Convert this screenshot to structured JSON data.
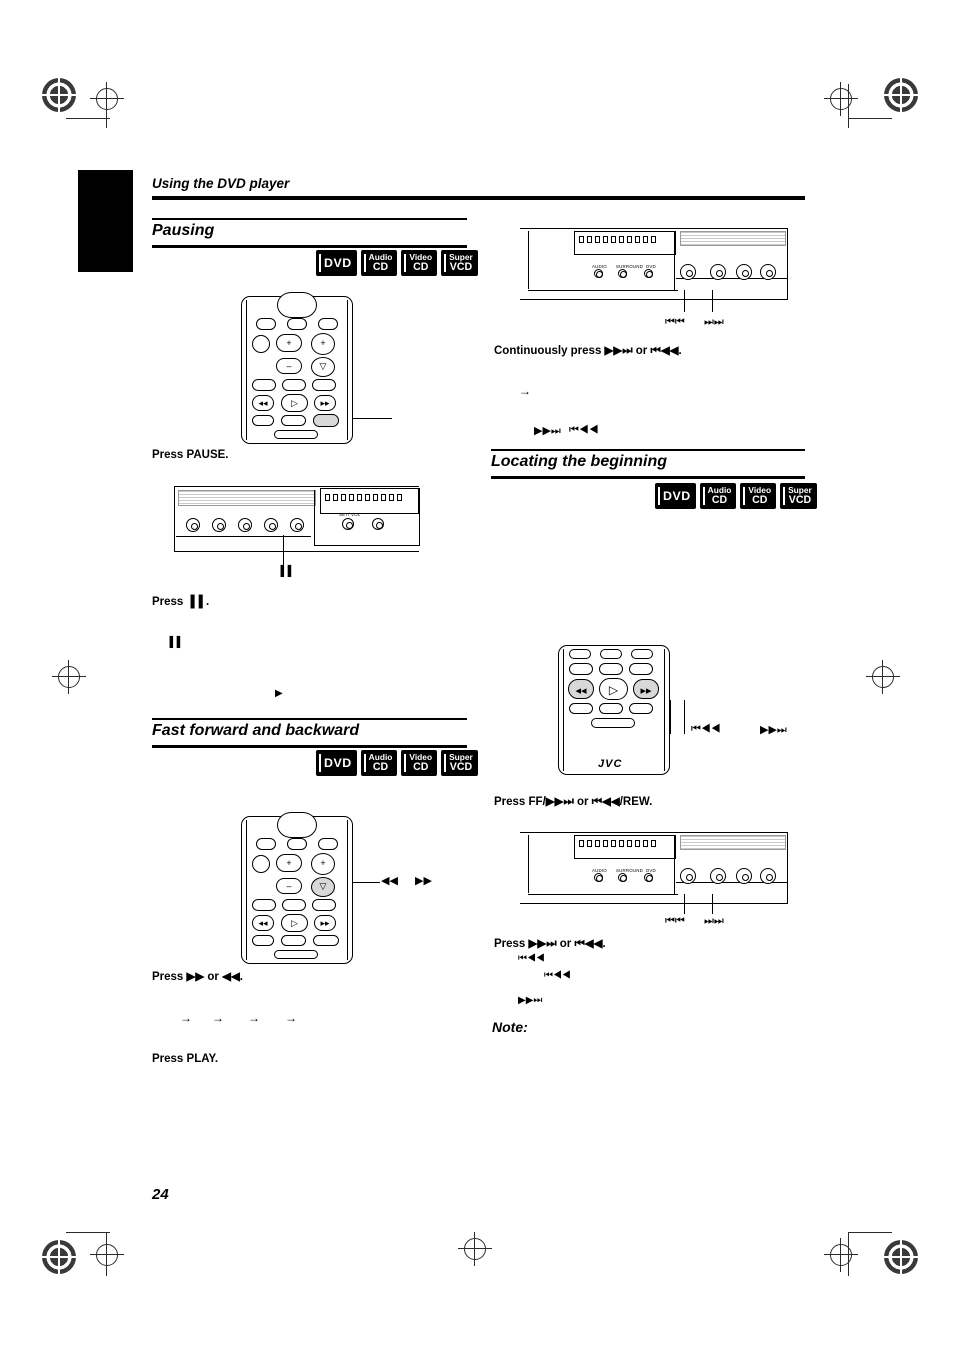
{
  "page": {
    "number": "24",
    "header": "Using the DVD player",
    "brand": "JVC"
  },
  "sections": [
    {
      "id": "pausing",
      "title": "Pausing",
      "badges": [
        {
          "l1": "DVD",
          "l2": "",
          "single": true
        },
        {
          "l1": "Audio",
          "l2": "CD",
          "single": false
        },
        {
          "l1": "Video",
          "l2": "CD",
          "single": false
        },
        {
          "l1": "Super",
          "l2": "VCD",
          "single": false
        }
      ],
      "steps": [
        {
          "label": "Press PAUSE."
        },
        {
          "label": "Press ▐▐ ."
        }
      ],
      "callout": "▐▐",
      "play_glyph": "▶"
    },
    {
      "id": "fast-forward-backward",
      "title": "Fast forward and backward",
      "badges": [
        {
          "l1": "DVD",
          "l2": "",
          "single": true
        },
        {
          "l1": "Audio",
          "l2": "CD",
          "single": false
        },
        {
          "l1": "Video",
          "l2": "CD",
          "single": false
        },
        {
          "l1": "Super",
          "l2": "VCD",
          "single": false
        }
      ],
      "remote_labels": {
        "rew": "◀◀",
        "ff": "▶▶"
      },
      "steps": [
        {
          "label": "Press ▶▶ or ◀◀."
        },
        {
          "label": "Press PLAY."
        }
      ],
      "panel_labels": {
        "rew": "⏮⏮",
        "ff": "⏭⏭"
      },
      "continuous": "Continuously press ▶▶⏭ or ⏮◀◀.",
      "arrows": [
        "→",
        "→",
        "→",
        "→"
      ],
      "bottom_glyphs": [
        "▶▶⏭",
        "⏮◀◀"
      ]
    },
    {
      "id": "locating-the-beginning",
      "title": "Locating the beginning",
      "badges": [
        {
          "l1": "DVD",
          "l2": "",
          "single": true
        },
        {
          "l1": "Audio",
          "l2": "CD",
          "single": false
        },
        {
          "l1": "Video",
          "l2": "CD",
          "single": false
        },
        {
          "l1": "Super",
          "l2": "VCD",
          "single": false
        }
      ],
      "remote_labels": {
        "prev": "⏮◀◀",
        "next": "▶▶⏭"
      },
      "steps": [
        {
          "label": "Press FF/▶▶⏭ or ⏮◀◀/REW."
        },
        {
          "label": "Press ▶▶⏭ or ⏮◀◀."
        }
      ],
      "panel_labels": {
        "prev": "⏮⏮",
        "next": "⏭⏭"
      },
      "sub_glyphs": [
        "⏮◀◀",
        "⏮◀◀",
        "▶▶⏭"
      ],
      "note_title": "Note:"
    }
  ],
  "panel_text": {
    "labels": [
      "AUDIO",
      "SURROUND",
      "DVD"
    ],
    "small": "SET/ VOL"
  }
}
